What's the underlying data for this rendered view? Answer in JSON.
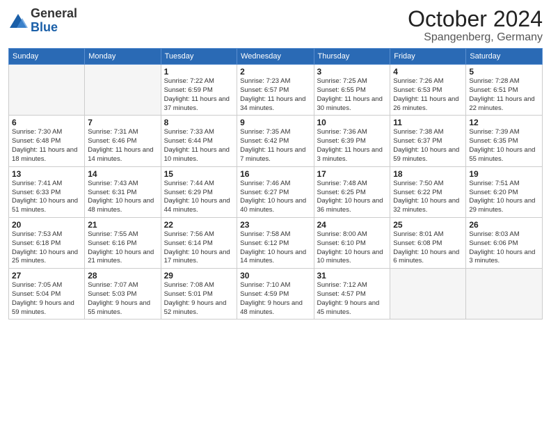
{
  "header": {
    "logo": {
      "general": "General",
      "blue": "Blue"
    },
    "title": "October 2024",
    "location": "Spangenberg, Germany"
  },
  "days_of_week": [
    "Sunday",
    "Monday",
    "Tuesday",
    "Wednesday",
    "Thursday",
    "Friday",
    "Saturday"
  ],
  "weeks": [
    [
      {
        "day": "",
        "info": ""
      },
      {
        "day": "",
        "info": ""
      },
      {
        "day": "1",
        "info": "Sunrise: 7:22 AM\nSunset: 6:59 PM\nDaylight: 11 hours\nand 37 minutes."
      },
      {
        "day": "2",
        "info": "Sunrise: 7:23 AM\nSunset: 6:57 PM\nDaylight: 11 hours\nand 34 minutes."
      },
      {
        "day": "3",
        "info": "Sunrise: 7:25 AM\nSunset: 6:55 PM\nDaylight: 11 hours\nand 30 minutes."
      },
      {
        "day": "4",
        "info": "Sunrise: 7:26 AM\nSunset: 6:53 PM\nDaylight: 11 hours\nand 26 minutes."
      },
      {
        "day": "5",
        "info": "Sunrise: 7:28 AM\nSunset: 6:51 PM\nDaylight: 11 hours\nand 22 minutes."
      }
    ],
    [
      {
        "day": "6",
        "info": "Sunrise: 7:30 AM\nSunset: 6:48 PM\nDaylight: 11 hours\nand 18 minutes."
      },
      {
        "day": "7",
        "info": "Sunrise: 7:31 AM\nSunset: 6:46 PM\nDaylight: 11 hours\nand 14 minutes."
      },
      {
        "day": "8",
        "info": "Sunrise: 7:33 AM\nSunset: 6:44 PM\nDaylight: 11 hours\nand 10 minutes."
      },
      {
        "day": "9",
        "info": "Sunrise: 7:35 AM\nSunset: 6:42 PM\nDaylight: 11 hours\nand 7 minutes."
      },
      {
        "day": "10",
        "info": "Sunrise: 7:36 AM\nSunset: 6:39 PM\nDaylight: 11 hours\nand 3 minutes."
      },
      {
        "day": "11",
        "info": "Sunrise: 7:38 AM\nSunset: 6:37 PM\nDaylight: 10 hours\nand 59 minutes."
      },
      {
        "day": "12",
        "info": "Sunrise: 7:39 AM\nSunset: 6:35 PM\nDaylight: 10 hours\nand 55 minutes."
      }
    ],
    [
      {
        "day": "13",
        "info": "Sunrise: 7:41 AM\nSunset: 6:33 PM\nDaylight: 10 hours\nand 51 minutes."
      },
      {
        "day": "14",
        "info": "Sunrise: 7:43 AM\nSunset: 6:31 PM\nDaylight: 10 hours\nand 48 minutes."
      },
      {
        "day": "15",
        "info": "Sunrise: 7:44 AM\nSunset: 6:29 PM\nDaylight: 10 hours\nand 44 minutes."
      },
      {
        "day": "16",
        "info": "Sunrise: 7:46 AM\nSunset: 6:27 PM\nDaylight: 10 hours\nand 40 minutes."
      },
      {
        "day": "17",
        "info": "Sunrise: 7:48 AM\nSunset: 6:25 PM\nDaylight: 10 hours\nand 36 minutes."
      },
      {
        "day": "18",
        "info": "Sunrise: 7:50 AM\nSunset: 6:22 PM\nDaylight: 10 hours\nand 32 minutes."
      },
      {
        "day": "19",
        "info": "Sunrise: 7:51 AM\nSunset: 6:20 PM\nDaylight: 10 hours\nand 29 minutes."
      }
    ],
    [
      {
        "day": "20",
        "info": "Sunrise: 7:53 AM\nSunset: 6:18 PM\nDaylight: 10 hours\nand 25 minutes."
      },
      {
        "day": "21",
        "info": "Sunrise: 7:55 AM\nSunset: 6:16 PM\nDaylight: 10 hours\nand 21 minutes."
      },
      {
        "day": "22",
        "info": "Sunrise: 7:56 AM\nSunset: 6:14 PM\nDaylight: 10 hours\nand 17 minutes."
      },
      {
        "day": "23",
        "info": "Sunrise: 7:58 AM\nSunset: 6:12 PM\nDaylight: 10 hours\nand 14 minutes."
      },
      {
        "day": "24",
        "info": "Sunrise: 8:00 AM\nSunset: 6:10 PM\nDaylight: 10 hours\nand 10 minutes."
      },
      {
        "day": "25",
        "info": "Sunrise: 8:01 AM\nSunset: 6:08 PM\nDaylight: 10 hours\nand 6 minutes."
      },
      {
        "day": "26",
        "info": "Sunrise: 8:03 AM\nSunset: 6:06 PM\nDaylight: 10 hours\nand 3 minutes."
      }
    ],
    [
      {
        "day": "27",
        "info": "Sunrise: 7:05 AM\nSunset: 5:04 PM\nDaylight: 9 hours\nand 59 minutes."
      },
      {
        "day": "28",
        "info": "Sunrise: 7:07 AM\nSunset: 5:03 PM\nDaylight: 9 hours\nand 55 minutes."
      },
      {
        "day": "29",
        "info": "Sunrise: 7:08 AM\nSunset: 5:01 PM\nDaylight: 9 hours\nand 52 minutes."
      },
      {
        "day": "30",
        "info": "Sunrise: 7:10 AM\nSunset: 4:59 PM\nDaylight: 9 hours\nand 48 minutes."
      },
      {
        "day": "31",
        "info": "Sunrise: 7:12 AM\nSunset: 4:57 PM\nDaylight: 9 hours\nand 45 minutes."
      },
      {
        "day": "",
        "info": ""
      },
      {
        "day": "",
        "info": ""
      }
    ]
  ]
}
